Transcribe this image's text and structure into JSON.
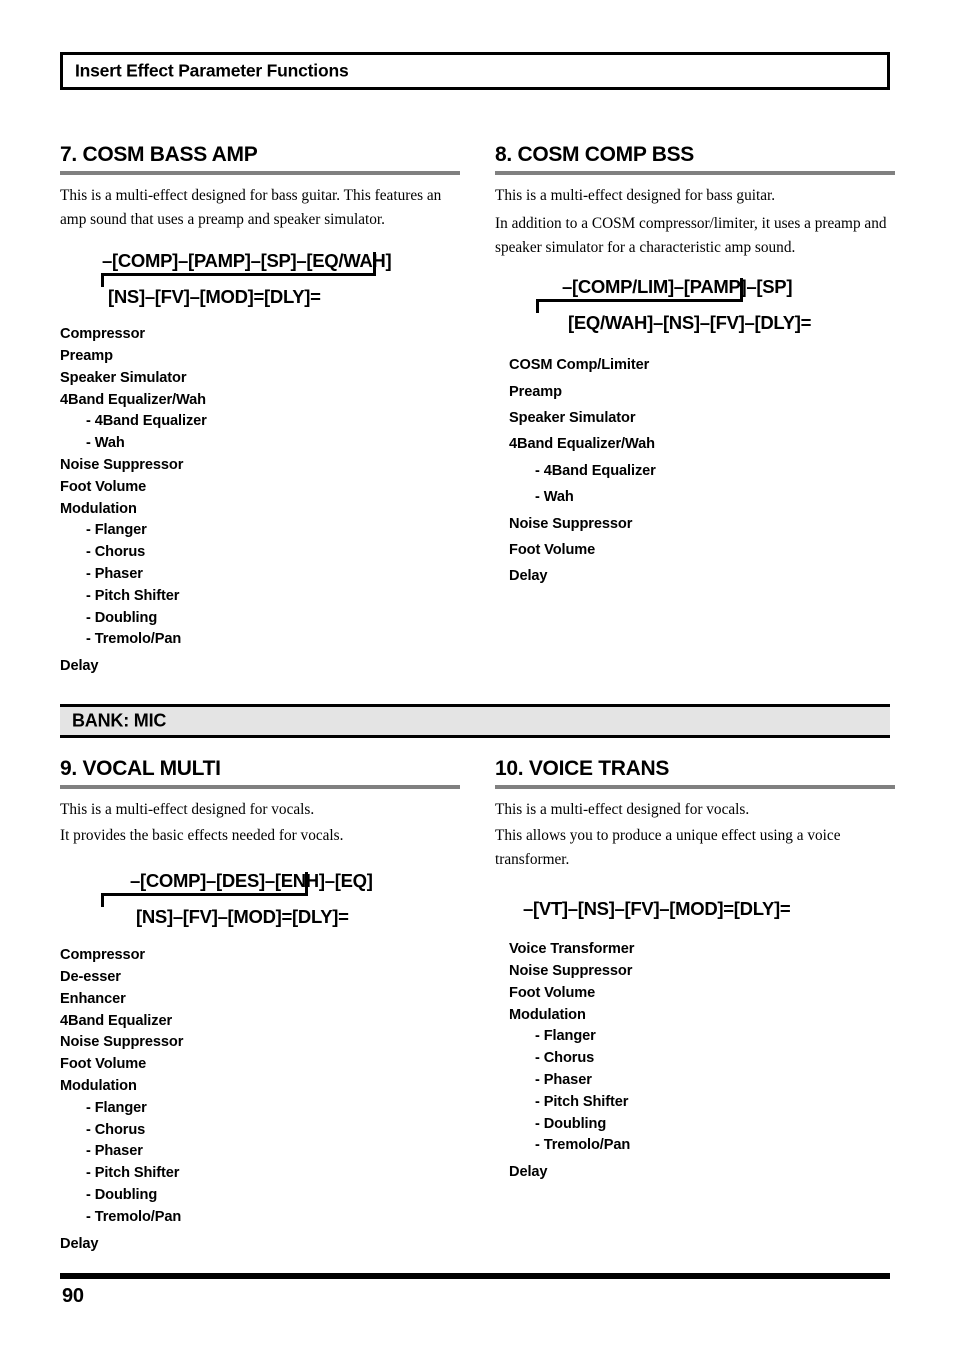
{
  "header": {
    "title": "Insert Effect Parameter Functions"
  },
  "bank_banner": {
    "label": "BANK: MIC"
  },
  "footer": {
    "page_number": "90"
  },
  "sections": [
    {
      "title": "7. COSM BASS AMP",
      "description": [
        "This is a multi-effect designed for bass guitar. This features an amp sound that uses a preamp and speaker simulator."
      ],
      "chain_line1": "–[COMP]–[PAMP]–[SP]–[EQ/WAH]",
      "chain_line2": "[NS]–[FV]–[MOD]=[DLY]=",
      "params": [
        {
          "label": "Compressor",
          "level": 1
        },
        {
          "label": "Preamp",
          "level": 1
        },
        {
          "label": "Speaker Simulator",
          "level": 1
        },
        {
          "label": "4Band Equalizer/Wah",
          "level": 1
        },
        {
          "label": "- 4Band Equalizer",
          "level": 2
        },
        {
          "label": "- Wah",
          "level": 2
        },
        {
          "label": "Noise Suppressor",
          "level": 1
        },
        {
          "label": "Foot Volume",
          "level": 1
        },
        {
          "label": "Modulation",
          "level": 1
        },
        {
          "label": "- Flanger",
          "level": 2
        },
        {
          "label": "- Chorus",
          "level": 2
        },
        {
          "label": "- Phaser",
          "level": 2
        },
        {
          "label": "- Pitch Shifter",
          "level": 2
        },
        {
          "label": "- Doubling",
          "level": 2
        },
        {
          "label": "- Tremolo/Pan",
          "level": 2
        },
        {
          "label": "Delay",
          "level": 1
        }
      ]
    },
    {
      "title": "8. COSM COMP BSS",
      "description": [
        "This is a multi-effect designed for bass guitar.",
        "In addition to a COSM compressor/limiter, it uses a preamp and speaker simulator for a characteristic amp sound."
      ],
      "chain_line1": "–[COMP/LIM]–[PAMP]–[SP]",
      "chain_line2": "[EQ/WAH]–[NS]–[FV]–[DLY]=",
      "params": [
        {
          "label": "COSM Comp/Limiter",
          "level": 1
        },
        {
          "label": "Preamp",
          "level": 1
        },
        {
          "label": "Speaker Simulator",
          "level": 1
        },
        {
          "label": "4Band Equalizer/Wah",
          "level": 1
        },
        {
          "label": "- 4Band Equalizer",
          "level": 2
        },
        {
          "label": "- Wah",
          "level": 2
        },
        {
          "label": "Noise Suppressor",
          "level": 1
        },
        {
          "label": "Foot Volume",
          "level": 1
        },
        {
          "label": "Delay",
          "level": 1
        }
      ]
    },
    {
      "title": "9. VOCAL MULTI",
      "description": [
        "This is a multi-effect designed for vocals.",
        "It provides the basic effects needed for vocals."
      ],
      "chain_line1": "–[COMP]–[DES]–[ENH]–[EQ]",
      "chain_line2": "[NS]–[FV]–[MOD]=[DLY]=",
      "params": [
        {
          "label": "Compressor",
          "level": 1
        },
        {
          "label": "De-esser",
          "level": 1
        },
        {
          "label": "Enhancer",
          "level": 1
        },
        {
          "label": "4Band Equalizer",
          "level": 1
        },
        {
          "label": "Noise Suppressor",
          "level": 1
        },
        {
          "label": "Foot Volume",
          "level": 1
        },
        {
          "label": "Modulation",
          "level": 1
        },
        {
          "label": "- Flanger",
          "level": 2
        },
        {
          "label": "- Chorus",
          "level": 2
        },
        {
          "label": "- Phaser",
          "level": 2
        },
        {
          "label": "- Pitch Shifter",
          "level": 2
        },
        {
          "label": "- Doubling",
          "level": 2
        },
        {
          "label": "- Tremolo/Pan",
          "level": 2
        },
        {
          "label": "Delay",
          "level": 1
        }
      ]
    },
    {
      "title": "10. VOICE TRANS",
      "description": [
        "This is a multi-effect designed for vocals.",
        "This allows you to produce a unique effect using a voice transformer."
      ],
      "chain_single": "–[VT]–[NS]–[FV]–[MOD]=[DLY]=",
      "params": [
        {
          "label": "Voice Transformer",
          "level": 1
        },
        {
          "label": "Noise Suppressor",
          "level": 1
        },
        {
          "label": "Foot Volume",
          "level": 1
        },
        {
          "label": "Modulation",
          "level": 1
        },
        {
          "label": "- Flanger",
          "level": 2
        },
        {
          "label": "- Chorus",
          "level": 2
        },
        {
          "label": "- Phaser",
          "level": 2
        },
        {
          "label": "- Pitch Shifter",
          "level": 2
        },
        {
          "label": "- Doubling",
          "level": 2
        },
        {
          "label": "- Tremolo/Pan",
          "level": 2
        },
        {
          "label": "Delay",
          "level": 1
        }
      ]
    }
  ]
}
